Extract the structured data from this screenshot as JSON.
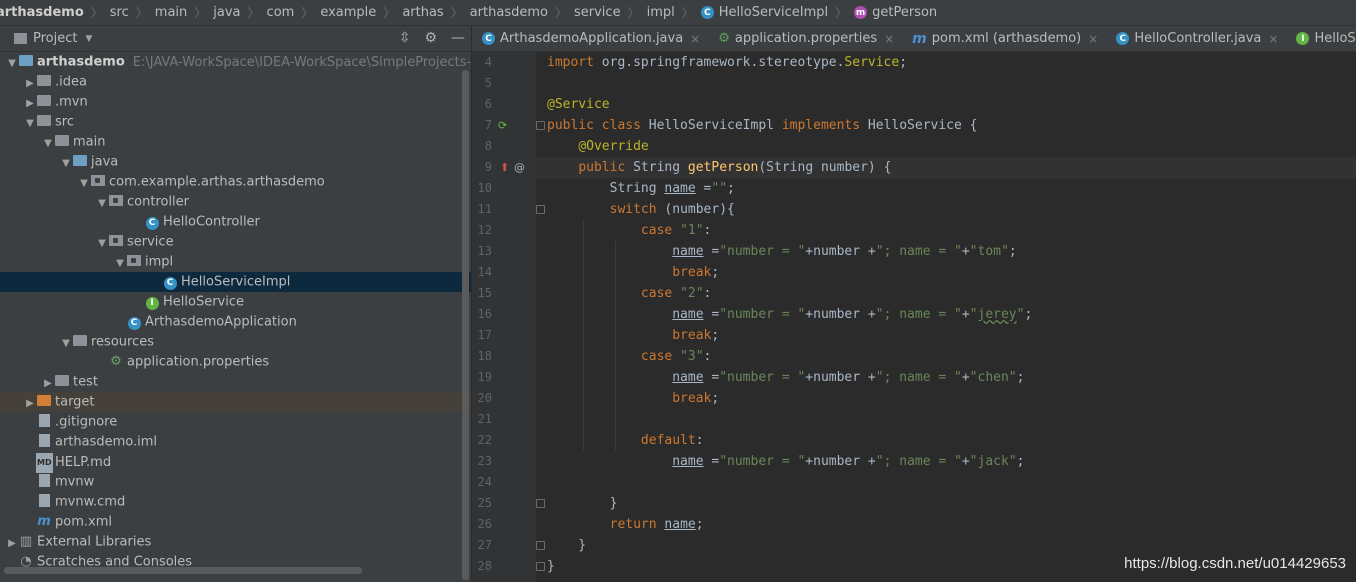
{
  "breadcrumb": [
    "arthasdemo",
    "src",
    "main",
    "java",
    "com",
    "example",
    "arthas",
    "arthasdemo",
    "service",
    "impl",
    "HelloServiceImpl",
    "getPerson"
  ],
  "project": {
    "title": "Project",
    "tree": [
      {
        "label": "arthasdemo",
        "path": "E:\\JAVA-WorkSpace\\IDEA-WorkSpace\\SimpleProjects-Work"
      },
      {
        "label": ".idea"
      },
      {
        "label": ".mvn"
      },
      {
        "label": "src"
      },
      {
        "label": "main"
      },
      {
        "label": "java"
      },
      {
        "label": "com.example.arthas.arthasdemo"
      },
      {
        "label": "controller"
      },
      {
        "label": "HelloController"
      },
      {
        "label": "service"
      },
      {
        "label": "impl"
      },
      {
        "label": "HelloServiceImpl"
      },
      {
        "label": "HelloService"
      },
      {
        "label": "ArthasdemoApplication"
      },
      {
        "label": "resources"
      },
      {
        "label": "application.properties"
      },
      {
        "label": "test"
      },
      {
        "label": "target"
      },
      {
        "label": ".gitignore"
      },
      {
        "label": "arthasdemo.iml"
      },
      {
        "label": "HELP.md"
      },
      {
        "label": "mvnw"
      },
      {
        "label": "mvnw.cmd"
      },
      {
        "label": "pom.xml"
      },
      {
        "label": "External Libraries"
      },
      {
        "label": "Scratches and Consoles"
      }
    ]
  },
  "tabs": [
    {
      "label": "ArthasdemoApplication.java"
    },
    {
      "label": "application.properties"
    },
    {
      "label": "pom.xml (arthasdemo)"
    },
    {
      "label": "HelloController.java"
    },
    {
      "label": "HelloService.java"
    }
  ],
  "editor": {
    "line_numbers": [
      "4",
      "5",
      "6",
      "7",
      "8",
      "9",
      "10",
      "11",
      "12",
      "13",
      "14",
      "15",
      "16",
      "17",
      "18",
      "19",
      "20",
      "21",
      "22",
      "23",
      "24",
      "25",
      "26",
      "27",
      "28"
    ]
  },
  "watermark": "https://blog.csdn.net/u014429653"
}
